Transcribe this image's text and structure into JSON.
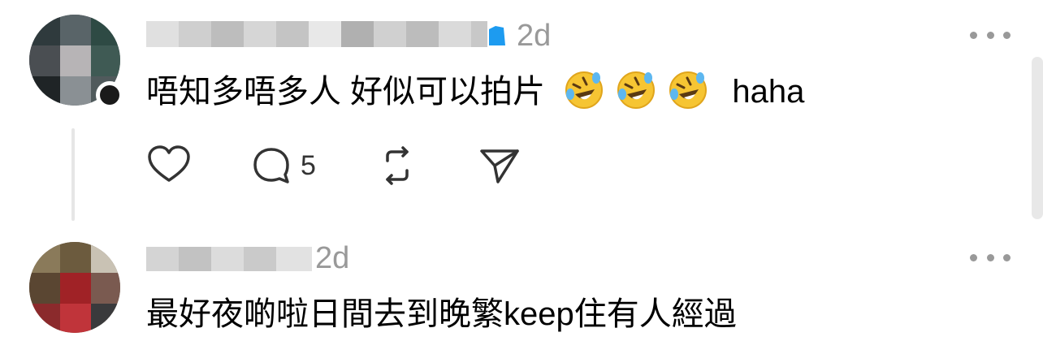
{
  "comments": [
    {
      "timestamp": "2d",
      "text": "唔知多唔多人 好似可以拍片",
      "emoji_icon": "rolling-on-floor-laughing",
      "emoji_count": 3,
      "suffix": "haha",
      "replies_count": "5"
    },
    {
      "timestamp": "2d",
      "text": "最好夜啲啦日間去到晚繁keep住有人經過"
    }
  ],
  "colors": {
    "meta_gray": "#999999",
    "text": "#000000",
    "icon": "#333333",
    "badge_blue": "#1d9bf0"
  }
}
